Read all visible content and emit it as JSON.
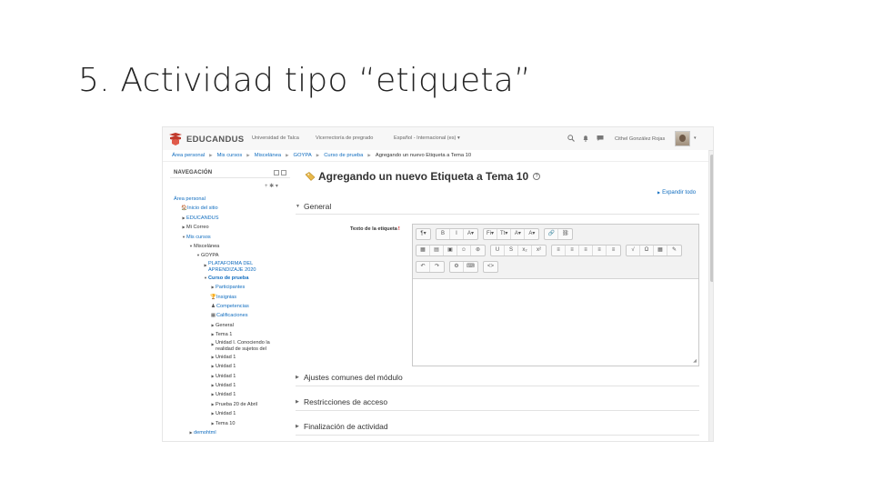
{
  "slide": {
    "title": "5. Actividad tipo “etiqueta”"
  },
  "navbar": {
    "brand": "EDUCANDUS",
    "links": [
      "Universidad de Talca",
      "Vicerrectoría de pregrado",
      "Español - Internacional (es) ▾"
    ],
    "icons": [
      "search-icon",
      "bell-icon",
      "chat-icon"
    ],
    "user_name": "Cithel González Rojas",
    "user_caret": "▾"
  },
  "breadcrumb": [
    "Área personal",
    "Mis cursos",
    "Miscelánea",
    "GOYPA",
    "Curso de prueba",
    "Agregando un nuevo Etiqueta a Tema 10"
  ],
  "nav_block": {
    "title": "NAVEGACIÓN",
    "actions": "+ ✱ ▾",
    "items": [
      {
        "label": "Área personal",
        "toggle": "",
        "icon": ""
      },
      {
        "label": "Inicio del sitio",
        "toggle": "",
        "icon": "🏠"
      },
      {
        "label": "EDUCANDUS",
        "toggle": "▶",
        "icon": ""
      },
      {
        "label": "Mi Correo",
        "toggle": "▶",
        "icon": ""
      },
      {
        "label": "Mis cursos",
        "toggle": "▼",
        "icon": ""
      },
      {
        "label": "Miscelánea",
        "toggle": "▼",
        "icon": ""
      },
      {
        "label": "GOYPA",
        "toggle": "▼",
        "icon": ""
      },
      {
        "label": "PLATAFORMA DEL APRENDIZAJE 2020",
        "toggle": "▶",
        "icon": ""
      },
      {
        "label": "Curso de prueba",
        "toggle": "▼",
        "icon": ""
      },
      {
        "label": "Participantes",
        "toggle": "▶",
        "icon": ""
      },
      {
        "label": "Insignias",
        "toggle": "",
        "icon": "🏆"
      },
      {
        "label": "Competencias",
        "toggle": "",
        "icon": "♟"
      },
      {
        "label": "Calificaciones",
        "toggle": "",
        "icon": "▦"
      },
      {
        "label": "General",
        "toggle": "▶",
        "icon": ""
      },
      {
        "label": "Tema 1",
        "toggle": "▶",
        "icon": ""
      },
      {
        "label": "Unidad I. Conociendo la realidad de sujetos del",
        "toggle": "▶",
        "icon": ""
      },
      {
        "label": "Unidad 1",
        "toggle": "▶",
        "icon": ""
      },
      {
        "label": "Unidad 1",
        "toggle": "▶",
        "icon": ""
      },
      {
        "label": "Unidad 1",
        "toggle": "▶",
        "icon": ""
      },
      {
        "label": "Unidad 1",
        "toggle": "▶",
        "icon": ""
      },
      {
        "label": "Unidad 1",
        "toggle": "▶",
        "icon": ""
      },
      {
        "label": "Prueba 20 de Abril",
        "toggle": "▶",
        "icon": ""
      },
      {
        "label": "Unidad 1",
        "toggle": "▶",
        "icon": ""
      },
      {
        "label": "Tema 10",
        "toggle": "▶",
        "icon": ""
      },
      {
        "label": "demohtml",
        "toggle": "▶",
        "icon": ""
      }
    ]
  },
  "main": {
    "heading": "Agregando un nuevo Etiqueta a Tema 10",
    "help": "?",
    "expand_all": "Expandir todo",
    "sections": {
      "general": "General",
      "common": "Ajustes comunes del módulo",
      "restrictions": "Restricciones de acceso",
      "completion": "Finalización de actividad"
    },
    "field_label": "Texto de la etiqueta",
    "required_mark": "!"
  },
  "editor": {
    "toolbar_rows": [
      [
        [
          "¶▾"
        ],
        [
          "B",
          "I",
          "A▾"
        ],
        [
          "Fi▾",
          "Tt▾",
          "A▾",
          "A▾"
        ],
        [
          "🔗",
          "⛓"
        ]
      ],
      [
        [
          "▦",
          "▤",
          "▣",
          "☺",
          "⊛"
        ],
        [
          "U",
          "S",
          "x₂",
          "x²"
        ],
        [
          "≡",
          "≡",
          "≡",
          "≡",
          "≡"
        ],
        [
          "√",
          "Ω",
          "▦",
          "✎"
        ]
      ],
      [
        [
          "↶",
          "↷"
        ],
        [
          "⚙",
          "⌨"
        ],
        [
          "<>"
        ]
      ]
    ],
    "resize_grip": "◢"
  },
  "colors": {
    "link": "#0f6cbf",
    "brand_red": "#c0392b"
  }
}
